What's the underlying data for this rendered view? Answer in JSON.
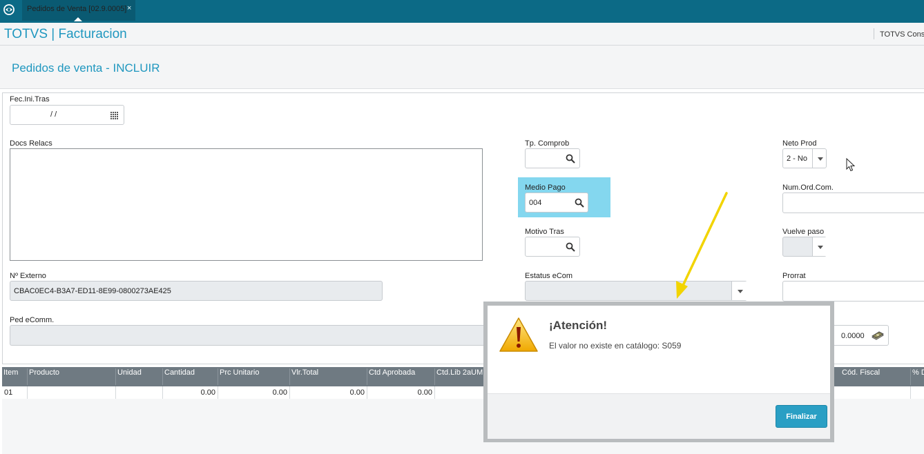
{
  "topbar": {
    "tab_label": "Pedidos de Venta [02.9.0005]",
    "tab_close": "×"
  },
  "header": {
    "app_title": "TOTVS | Facturacion",
    "user_text": "TOTVS Cons"
  },
  "page": {
    "title": "Pedidos de venta - INCLUIR"
  },
  "form": {
    "fec_ini_tras": {
      "label": "Fec.Ini.Tras",
      "value": " / /"
    },
    "docs_relacs": {
      "label": "Docs Relacs",
      "value": ""
    },
    "tp_comprob": {
      "label": "Tp. Comprob",
      "value": ""
    },
    "neto_prod": {
      "label": "Neto Prod",
      "value": "2 - No"
    },
    "medio_pago": {
      "label": "Medio Pago",
      "value": "004"
    },
    "num_ord_com": {
      "label": "Num.Ord.Com.",
      "value": ""
    },
    "motivo_tras": {
      "label": "Motivo Tras",
      "value": ""
    },
    "vuelve_paso": {
      "label": "Vuelve paso",
      "value": ""
    },
    "nro_externo": {
      "label": "Nº Externo",
      "value": "CBAC0EC4-B3A7-ED11-8E99-0800273AE425"
    },
    "estatus_ecom": {
      "label": "Estatus eCom",
      "value": ""
    },
    "prorrat": {
      "label": "Prorrat",
      "value": ""
    },
    "ped_ecomm": {
      "label": "Ped eComm.",
      "value": ""
    },
    "amount": {
      "value": "0.0000"
    }
  },
  "grid": {
    "columns": [
      "Item",
      "Producto",
      "Unidad",
      "Cantidad",
      "Prc Unitario",
      "Vlr.Total",
      "Ctd Aprobada",
      "Ctd.Lib 2aUM",
      "Cód. Fiscal",
      "% D"
    ],
    "rows": [
      [
        "01",
        "",
        "",
        "0.00",
        "0.00",
        "0.00",
        "0.00",
        "",
        "",
        ""
      ]
    ]
  },
  "dialog": {
    "title": "¡Atención!",
    "message": "El valor no existe en catálogo: S059",
    "button": "Finalizar"
  },
  "colors": {
    "topbar": "#0c6a86",
    "accent": "#1f97bf",
    "highlight": "#84d7ef",
    "grid_header": "#6f7a82",
    "button": "#2a9fc4",
    "arrow": "#f2d400"
  }
}
